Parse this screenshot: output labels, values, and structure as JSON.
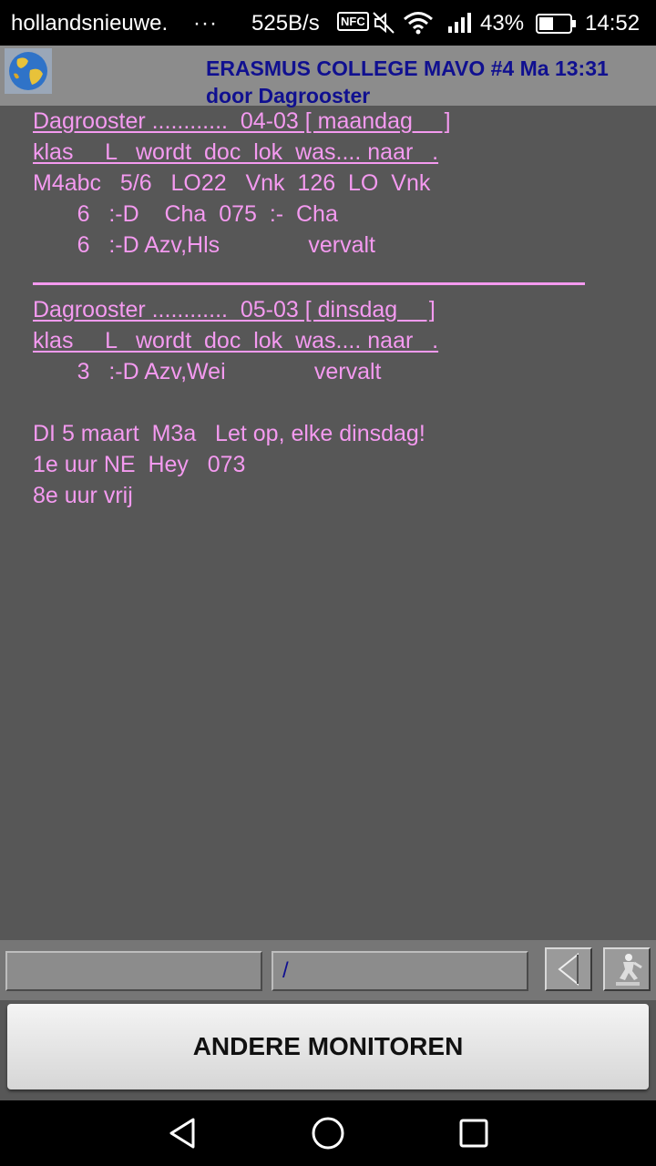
{
  "status_bar": {
    "app": "hollandsnieuwe.",
    "dots": "···",
    "speed": "525B/s",
    "nfc": "NFC",
    "battery": "43%",
    "time": "14:52"
  },
  "header": {
    "title": "ERASMUS COLLEGE MAVO #4  Ma 13:31",
    "subtitle": "door Dagrooster"
  },
  "schedule": {
    "day1": {
      "heading": "Dagrooster ............  04-03 [ maandag     ]",
      "columns": "klas     L   wordt  doc  lok  was.... naar   .",
      "rows": [
        "M4abc   5/6   LO22   Vnk  126  LO  Vnk",
        "       6   :-D    Cha  075  :-  Cha",
        "       6   :-D Azv,Hls              vervalt"
      ]
    },
    "day2": {
      "heading": "Dagrooster ............  05-03 [ dinsdag     ]",
      "columns": "klas     L   wordt  doc  lok  was.... naar   .",
      "rows": [
        "       3   :-D Azv,Wei              vervalt"
      ]
    },
    "notes": [
      "DI 5 maart  M3a   Let op, elke dinsdag!",
      "1e uur NE  Hey   073",
      "8e uur vrij"
    ]
  },
  "bottom": {
    "field1_value": "",
    "field2_value": "/",
    "main_button": "ANDERE MONITOREN"
  }
}
